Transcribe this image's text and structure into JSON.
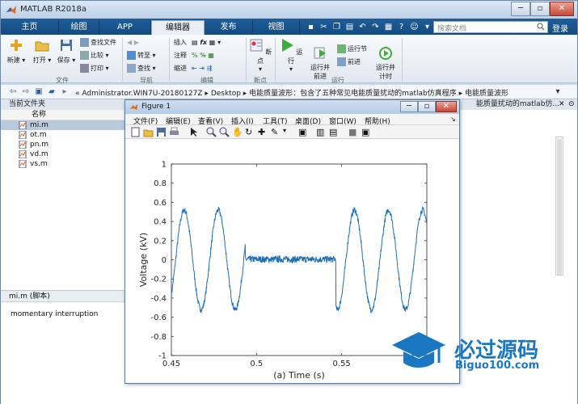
{
  "window": {
    "title": "MATLAB R2018a"
  },
  "tabs": [
    "主页",
    "绘图",
    "APP",
    "编辑器",
    "发布",
    "视图"
  ],
  "search": {
    "placeholder": "搜索文档"
  },
  "login_label": "登录",
  "ribbon": {
    "file_group": {
      "label": "文件",
      "new": "新建",
      "open": "打开",
      "save": "保存",
      "find_files": "查找文件",
      "compare": "比较",
      "print": "打印"
    },
    "nav_group": {
      "label": "导航",
      "goto": "转至",
      "find": "查找"
    },
    "edit_group": {
      "label": "编辑",
      "insert": "插入",
      "comment": "注释",
      "indent": "缩进"
    },
    "breakpoint_group": {
      "label": "断点",
      "breakpoints": "断点"
    },
    "run_group": {
      "label": "运行",
      "run": "运行",
      "run_advance": "运行并\n前进",
      "run_section": "运行节",
      "advance": "前进",
      "run_time": "运行并\n计时"
    }
  },
  "address": {
    "path": "« Administrator.WIN7U-20180127Z ▸ Desktop ▸ 电能质量波形：包含了五种常见电能质量扰动的matlab仿真程序 ▸ 电能质量波形"
  },
  "left_panel": {
    "title": "当前文件夹",
    "column_header": "名称",
    "files": [
      "mi.m",
      "ot.m",
      "pn.m",
      "vd.m",
      "vs.m"
    ]
  },
  "details": {
    "title": "mi.m  (脚本)",
    "description": "momentary interruption"
  },
  "right_panel": {
    "title": "能质量扰动的matlab仿..."
  },
  "figure": {
    "title": "Figure 1",
    "menus": [
      "文件(F)",
      "编辑(E)",
      "查看(V)",
      "插入(I)",
      "工具(T)",
      "桌面(D)",
      "窗口(W)",
      "帮助(H)"
    ]
  },
  "chart_data": {
    "type": "line",
    "title": "",
    "xlabel": "(a)  Time (s)",
    "ylabel": "Voltage (kV)",
    "xlim": [
      0.45,
      0.6
    ],
    "ylim": [
      -1,
      1
    ],
    "xticks": [
      0.45,
      0.5,
      0.55
    ],
    "yticks": [
      -1,
      -0.8,
      -0.6,
      -0.4,
      -0.2,
      0,
      0.2,
      0.4,
      0.6,
      0.8,
      1
    ],
    "series": [
      {
        "color": "#1f6fb4",
        "description_points": [
          {
            "x": 0.45,
            "y": -0.42
          },
          {
            "x": 0.46,
            "y": 0.3
          },
          {
            "x": 0.4625,
            "y": 0.52
          },
          {
            "x": 0.4725,
            "y": -0.52
          },
          {
            "x": 0.4825,
            "y": 0.52
          },
          {
            "x": 0.4925,
            "y": -0.54
          },
          {
            "x": 0.495,
            "y": 0.0
          },
          {
            "x": 0.545,
            "y": 0.0
          },
          {
            "x": 0.5525,
            "y": 0.5
          },
          {
            "x": 0.5625,
            "y": -0.52
          },
          {
            "x": 0.5725,
            "y": 0.52
          },
          {
            "x": 0.5825,
            "y": -0.54
          },
          {
            "x": 0.6,
            "y": 0.5
          }
        ],
        "interruption": {
          "start": 0.4935,
          "end": 0.5465,
          "amplitude": 0.05
        },
        "sine": {
          "amplitude": 0.52,
          "frequency_hz": 50,
          "phase_ref": 0.4575
        }
      }
    ]
  },
  "watermark": {
    "text": "必过源码",
    "url": "Biguo100.com"
  }
}
